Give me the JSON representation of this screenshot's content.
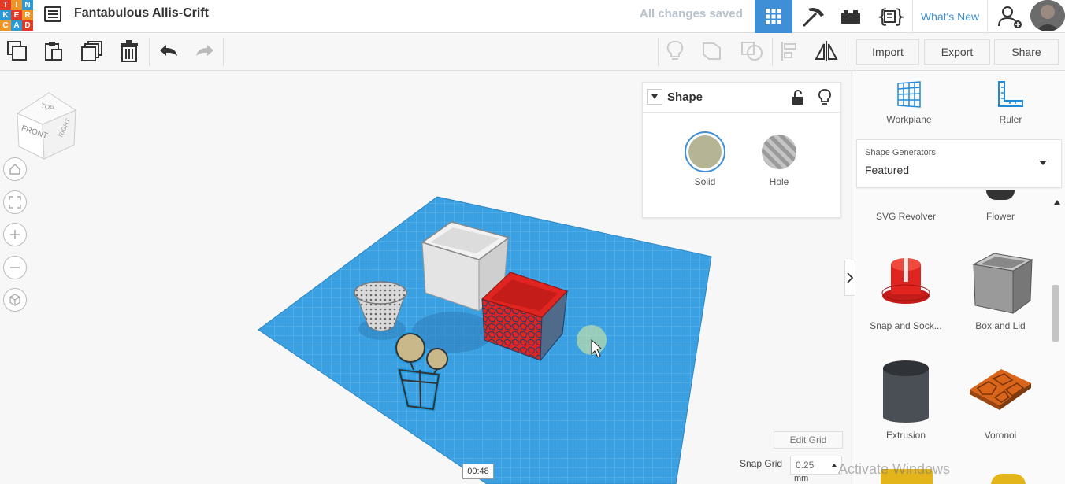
{
  "app": {
    "logo_letters": [
      "T",
      "I",
      "N",
      "K",
      "E",
      "R",
      "C",
      "A",
      "D"
    ],
    "logo_colors": [
      "#e23826",
      "#f09528",
      "#2c9ad7",
      "#2c9ad7",
      "#e23826",
      "#f09528",
      "#f09528",
      "#2c9ad7",
      "#e23826"
    ],
    "project_title": "Fantabulous Allis-Crift",
    "save_status": "All changes saved",
    "whats_new": "What's New"
  },
  "toolbar": {
    "import_label": "Import",
    "export_label": "Export",
    "share_label": "Share"
  },
  "viewcube": {
    "top": "TOP",
    "front": "FRONT",
    "right": "RIGHT"
  },
  "inspector": {
    "title": "Shape",
    "solid_label": "Solid",
    "hole_label": "Hole",
    "solid_color": "#b5b595"
  },
  "panel": {
    "workplane_label": "Workplane",
    "ruler_label": "Ruler",
    "generators_label": "Shape Generators",
    "generators_value": "Featured",
    "items": [
      {
        "label": "SVG Revolver",
        "icon": "svg-revolver-icon"
      },
      {
        "label": "Flower",
        "icon": "flower-icon"
      },
      {
        "label": "Snap and Sock...",
        "icon": "snap-and-socket-icon"
      },
      {
        "label": "Box and Lid",
        "icon": "box-and-lid-icon"
      },
      {
        "label": "Extrusion",
        "icon": "extrusion-icon"
      },
      {
        "label": "Voronoi",
        "icon": "voronoi-icon"
      }
    ]
  },
  "grid": {
    "edit_grid": "Edit Grid",
    "snap_label": "Snap Grid",
    "snap_value": "0.25",
    "snap_unit": "mm"
  },
  "overlay": {
    "timer": "00:48",
    "watermark": "Activate Windows"
  },
  "colors": {
    "accent": "#3f8fd6",
    "workplane": "#3aa0e2",
    "red_box": "#e02420"
  }
}
